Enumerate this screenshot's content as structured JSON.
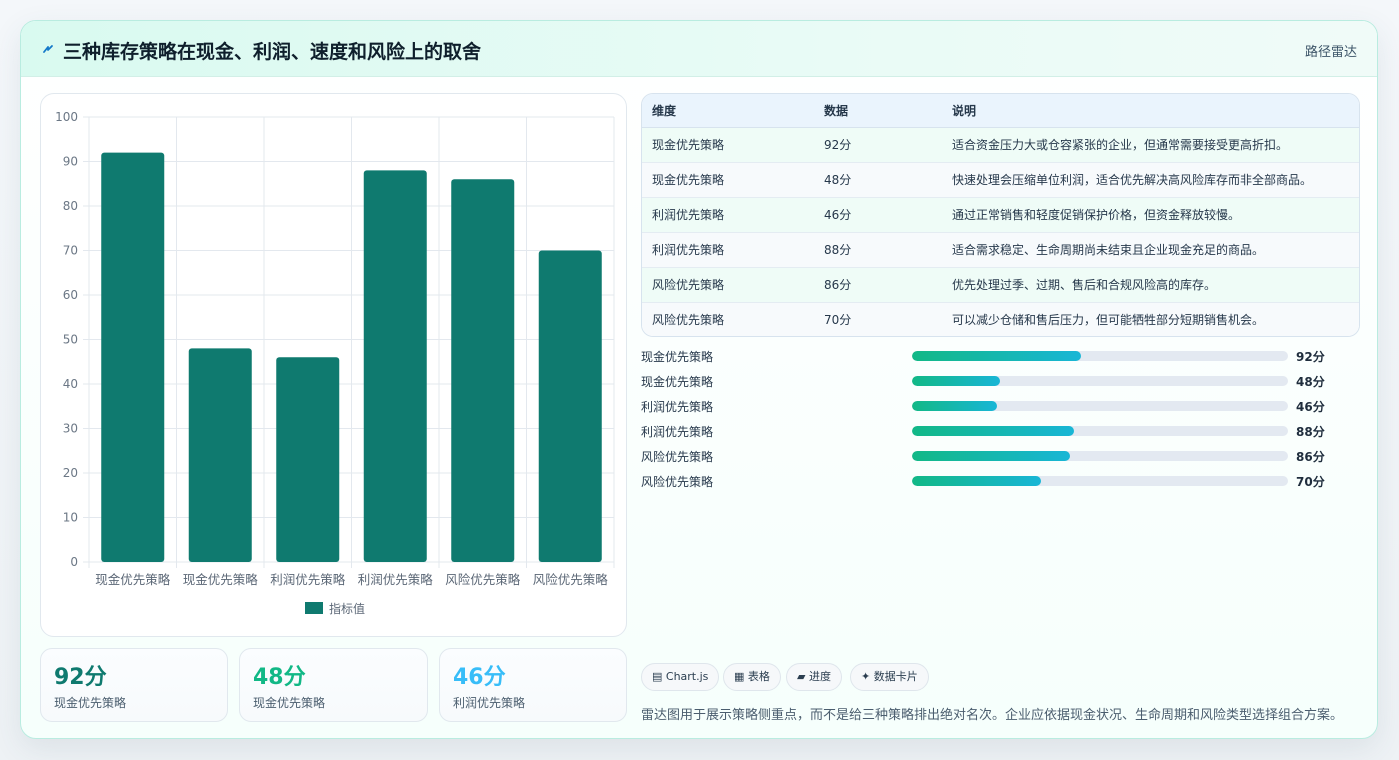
{
  "header": {
    "title": "三种库存策略在现金、利润、速度和风险上的取舍",
    "tag": "路径雷达"
  },
  "colors": {
    "bar": "#0f7a6f",
    "kpi_1": "#0f7a6f",
    "kpi_2": "#12b886",
    "kpi_3": "#38bdf8",
    "progress_start": "#12b886",
    "progress_end": "#18b6d6"
  },
  "chart_data": {
    "type": "bar",
    "categories": [
      "现金优先策略",
      "现金优先策略",
      "利润优先策略",
      "利润优先策略",
      "风险优先策略",
      "风险优先策略"
    ],
    "series": [
      {
        "name": "指标值",
        "values": [
          92,
          48,
          46,
          88,
          86,
          70
        ]
      }
    ],
    "ylim": [
      0,
      100
    ],
    "yticks": [
      "0",
      "10",
      "20",
      "30",
      "40",
      "50",
      "60",
      "70",
      "80",
      "90",
      "100"
    ],
    "grid": true,
    "legend": "bottom"
  },
  "kpis": [
    {
      "value": "92分",
      "label": "现金优先策略"
    },
    {
      "value": "48分",
      "label": "现金优先策略"
    },
    {
      "value": "46分",
      "label": "利润优先策略"
    }
  ],
  "table": {
    "headers": [
      "维度",
      "数据",
      "说明"
    ],
    "rows": [
      [
        "现金优先策略",
        "92分",
        "适合资金压力大或仓容紧张的企业，但通常需要接受更高折扣。"
      ],
      [
        "现金优先策略",
        "48分",
        "快速处理会压缩单位利润，适合优先解决高风险库存而非全部商品。"
      ],
      [
        "利润优先策略",
        "46分",
        "通过正常销售和轻度促销保护价格，但资金释放较慢。"
      ],
      [
        "利润优先策略",
        "88分",
        "适合需求稳定、生命周期尚未结束且企业现金充足的商品。"
      ],
      [
        "风险优先策略",
        "86分",
        "优先处理过季、过期、售后和合规风险高的库存。"
      ],
      [
        "风险优先策略",
        "70分",
        "可以减少仓储和售后压力，但可能牺牲部分短期销售机会。"
      ]
    ]
  },
  "progress": [
    {
      "label": "现金优先策略",
      "value_text": "92分",
      "fraction": 0.45
    },
    {
      "label": "现金优先策略",
      "value_text": "48分",
      "fraction": 0.235
    },
    {
      "label": "利润优先策略",
      "value_text": "46分",
      "fraction": 0.225
    },
    {
      "label": "利润优先策略",
      "value_text": "88分",
      "fraction": 0.43
    },
    {
      "label": "风险优先策略",
      "value_text": "86分",
      "fraction": 0.42
    },
    {
      "label": "风险优先策略",
      "value_text": "70分",
      "fraction": 0.343
    }
  ],
  "chips": [
    "▤ Chart.js",
    "▦ 表格",
    "▰ 进度",
    "✦ 数据卡片"
  ],
  "note": "雷达图用于展示策略侧重点，而不是给三种策略排出绝对名次。企业应依据现金状况、生命周期和风险类型选择组合方案。"
}
